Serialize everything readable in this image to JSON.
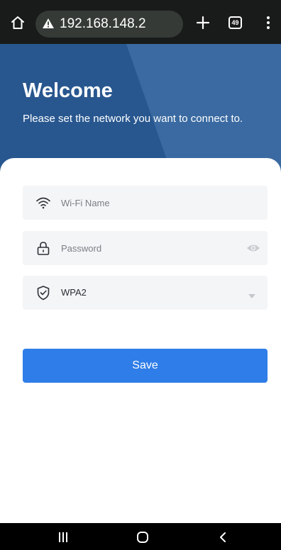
{
  "browser": {
    "url": "192.168.148.2",
    "tab_count": "49",
    "icons": {
      "home": "home-icon",
      "warning": "warning-triangle-icon",
      "new_tab": "plus-icon",
      "tabs": "tab-switcher-icon",
      "menu": "overflow-menu-icon"
    }
  },
  "header": {
    "title": "Welcome",
    "subtitle": "Please set the network you want to connect to."
  },
  "form": {
    "wifi_name": {
      "placeholder": "Wi-Fi Name",
      "value": "",
      "icon": "wifi-icon"
    },
    "password": {
      "placeholder": "Password",
      "value": "",
      "icon": "lock-icon",
      "toggle_icon": "eye-icon"
    },
    "security": {
      "selected": "WPA2",
      "icon": "shield-check-icon",
      "dropdown_icon": "caret-down-icon"
    },
    "save_label": "Save"
  },
  "nav_bar": {
    "icons": {
      "recents": "recents-icon",
      "home": "home-circle-icon",
      "back": "back-chevron-icon"
    }
  },
  "colors": {
    "browser_bar": "#181b19",
    "url_pill": "#353a36",
    "header_bg": "#2f5e97",
    "field_bg": "#f4f5f7",
    "primary_button": "#2f7de8",
    "nav_bar": "#000000"
  }
}
